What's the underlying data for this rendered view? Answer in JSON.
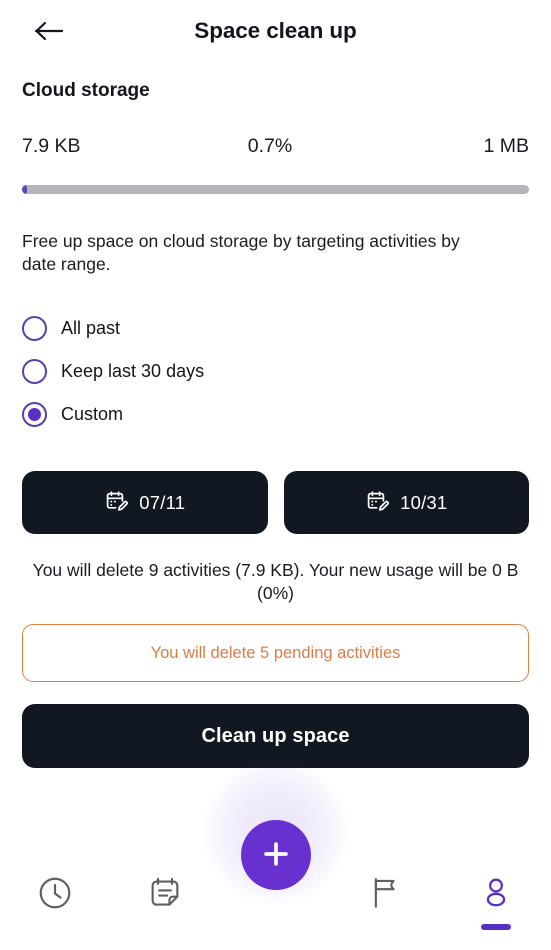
{
  "header": {
    "back_icon": "arrow-left-icon",
    "title": "Space clean up"
  },
  "storage": {
    "section_title": "Cloud storage",
    "used": "7.9 KB",
    "percent_label": "0.7%",
    "total": "1 MB",
    "percent_value": 0.7,
    "bar_track_color": "#b4b4b9",
    "bar_fill_color": "#5b45a8"
  },
  "description": "Free up space on cloud storage by targeting activities by date range.",
  "options": [
    {
      "id": "all-past",
      "label": "All past",
      "selected": false
    },
    {
      "id": "keep-last-30-days",
      "label": "Keep last 30 days",
      "selected": false
    },
    {
      "id": "custom",
      "label": "Custom",
      "selected": true
    }
  ],
  "date_range": {
    "start": {
      "icon": "calendar-edit-icon",
      "value": "07/11"
    },
    "end": {
      "icon": "calendar-edit-icon",
      "value": "10/31"
    }
  },
  "summary": "You will delete 9 activities (7.9 KB). Your new usage will be 0 B (0%)",
  "warning": {
    "text": "You will delete 5 pending activities",
    "color": "#df7c44"
  },
  "cta": {
    "label": "Clean up space",
    "background": "#111821"
  },
  "bottom_nav": {
    "accent": "#5b2fc4",
    "fab": {
      "icon": "plus-icon",
      "color": "#6930d0"
    },
    "items": [
      {
        "id": "history",
        "icon": "clock-icon",
        "active": false
      },
      {
        "id": "notes",
        "icon": "note-icon",
        "active": false
      },
      {
        "id": "goals",
        "icon": "flag-icon",
        "active": false
      },
      {
        "id": "profile",
        "icon": "person-icon",
        "active": true
      }
    ]
  }
}
